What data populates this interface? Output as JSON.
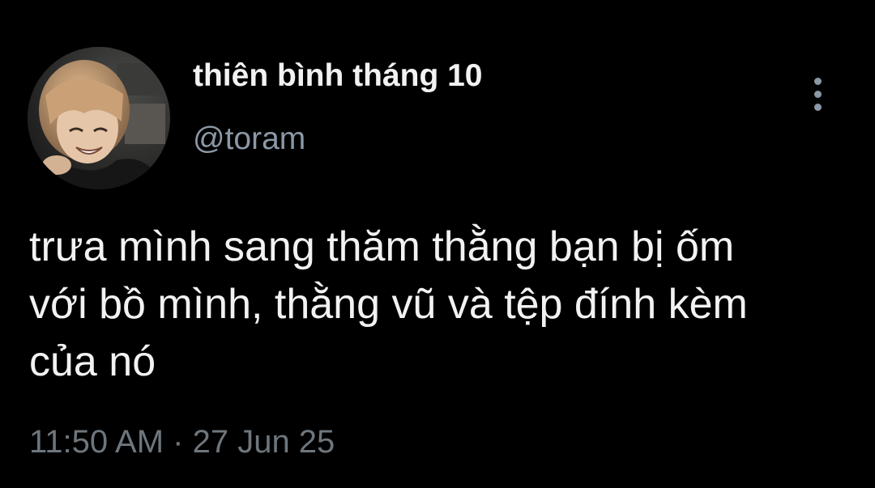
{
  "author": {
    "display_name": "thiên bình tháng 10",
    "handle": "@toram",
    "avatar_icon": "profile-photo"
  },
  "menu": {
    "icon": "more-vertical-icon"
  },
  "tweet": {
    "lines": [
      "trưa mình sang thăm thằng bạn bị ốm",
      "với bồ mình, thằng vũ và tệp đính kèm",
      "của nó"
    ]
  },
  "meta": {
    "time": "11:50 AM",
    "separator": " · ",
    "date": "27 Jun 25"
  },
  "colors": {
    "background": "#000000",
    "primary_text": "#f2f2f2",
    "secondary_text": "#8b98a5",
    "timestamp_text": "#6e767d"
  }
}
